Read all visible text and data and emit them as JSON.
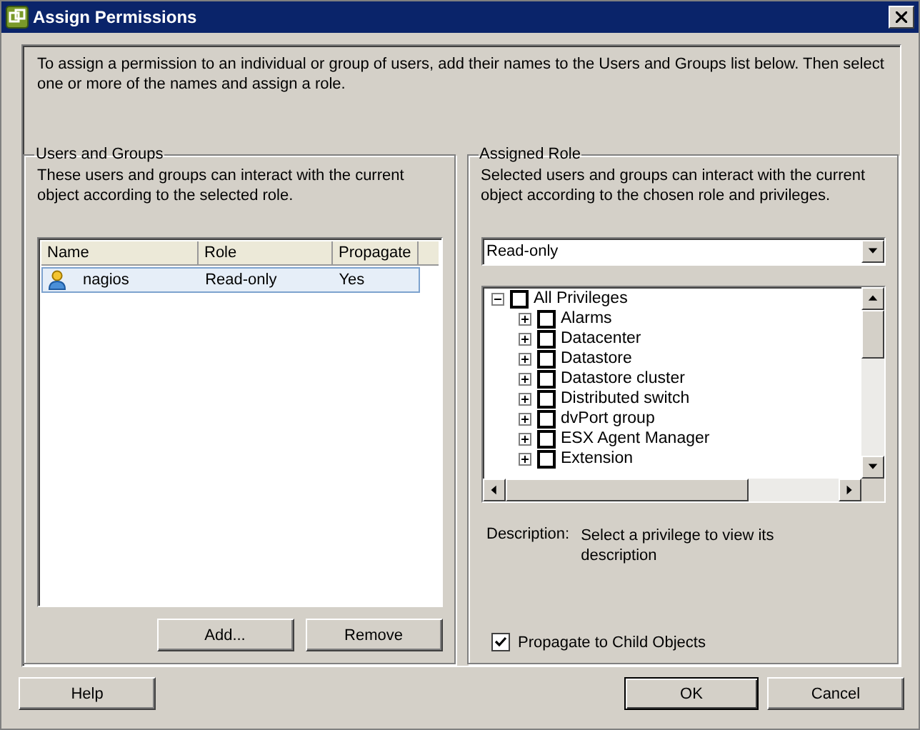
{
  "window": {
    "title": "Assign Permissions"
  },
  "intro": "To assign a permission to an individual or group of users, add their names to the Users and Groups list below. Then select one or more of the names and assign a role.",
  "users_groups": {
    "title": "Users and Groups",
    "description": "These users and groups can interact with the current object according to the selected role.",
    "columns": [
      "Name",
      "Role",
      "Propagate"
    ],
    "rows": [
      {
        "cells": [
          "nagios",
          "Read-only",
          "Yes"
        ],
        "selected": true
      }
    ],
    "buttons": [
      "Add...",
      "Remove"
    ]
  },
  "assigned_role": {
    "title": "Assigned Role",
    "description": "Selected users and groups can interact with the current object according to the chosen role and privileges.",
    "role": "Read-only",
    "privileges": {
      "label": "All Privileges",
      "expanded": true,
      "checked": false,
      "children": [
        {
          "label": "Alarms",
          "expanded": false,
          "checked": false
        },
        {
          "label": "Datacenter",
          "expanded": false,
          "checked": false
        },
        {
          "label": "Datastore",
          "expanded": false,
          "checked": false
        },
        {
          "label": "Datastore cluster",
          "expanded": false,
          "checked": false
        },
        {
          "label": "Distributed switch",
          "expanded": false,
          "checked": false
        },
        {
          "label": "dvPort group",
          "expanded": false,
          "checked": false
        },
        {
          "label": "ESX Agent Manager",
          "expanded": false,
          "checked": false
        },
        {
          "label": "Extension",
          "expanded": false,
          "checked": false
        }
      ]
    },
    "description_label": "Description:",
    "description_text": "Select a privilege to view its description",
    "propagate": {
      "label": "Propagate to Child Objects",
      "checked": true
    }
  },
  "buttons": {
    "help": "Help",
    "ok": "OK",
    "cancel": "Cancel"
  }
}
